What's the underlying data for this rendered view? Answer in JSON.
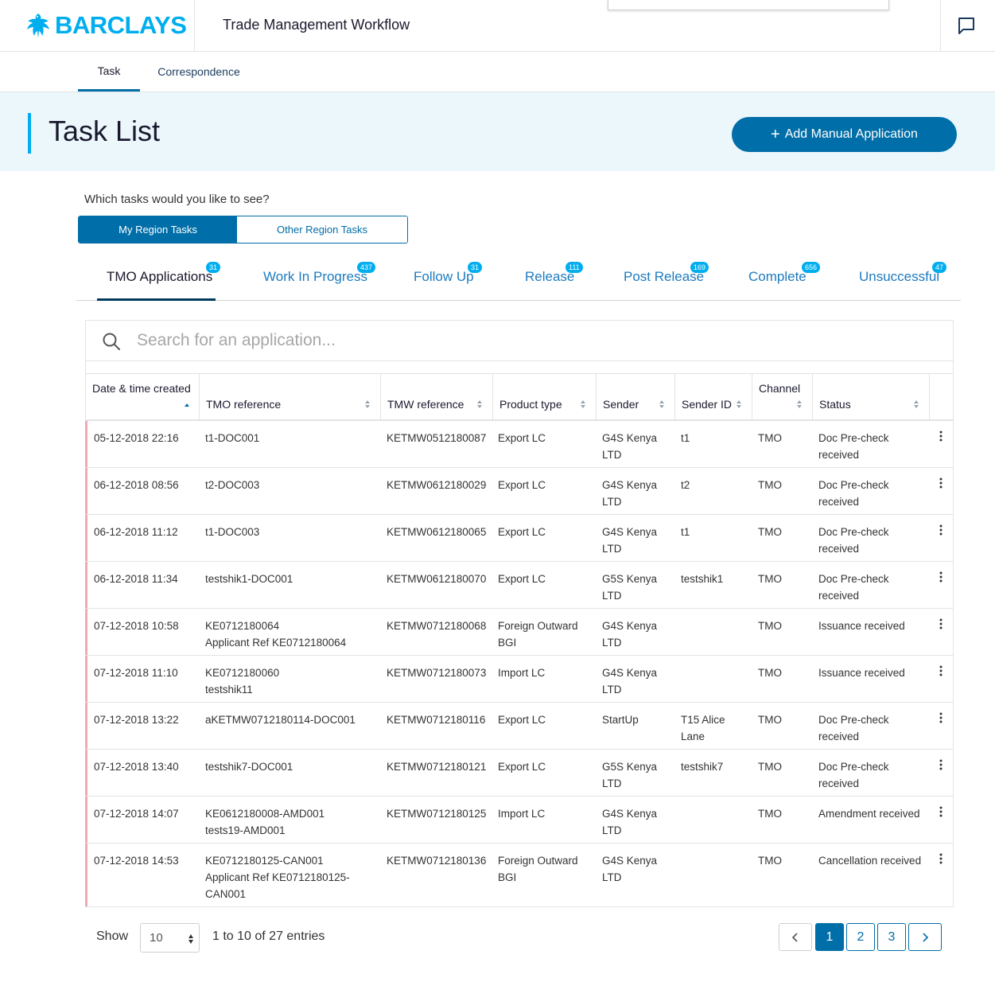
{
  "header": {
    "brand": "BARCLAYS",
    "app_title": "Trade Management Workflow",
    "chat_icon": "chat-icon"
  },
  "nav": {
    "tabs": [
      {
        "label": "Task",
        "active": true
      },
      {
        "label": "Correspondence",
        "active": false
      }
    ]
  },
  "banner": {
    "title": "Task List",
    "add_button": "Add Manual Application"
  },
  "filter": {
    "question": "Which tasks would you like to see?",
    "options": [
      "My Region Tasks",
      "Other Region Tasks"
    ],
    "selected": "My Region Tasks"
  },
  "status_tabs": [
    {
      "label": "TMO Applications",
      "count": "31",
      "active": true
    },
    {
      "label": "Work In Progress",
      "count": "437"
    },
    {
      "label": "Follow Up",
      "count": "31"
    },
    {
      "label": "Release",
      "count": "111"
    },
    {
      "label": "Post Release",
      "count": "169"
    },
    {
      "label": "Complete",
      "count": "656"
    },
    {
      "label": "Unsuccessful",
      "count": "47"
    }
  ],
  "search": {
    "placeholder": "Search for an application..."
  },
  "table": {
    "columns": [
      "Date & time created",
      "TMO reference",
      "TMW reference",
      "Product type",
      "Sender",
      "Sender ID",
      "Channel",
      "Status"
    ],
    "rows": [
      {
        "date": "05-12-2018 22:16",
        "tmo1": "t1-DOC001",
        "tmo2": "",
        "tmo3": "",
        "tmw": "KETMW0512180087",
        "prod1": "Export LC",
        "prod2": "",
        "send1": "G4S Kenya",
        "send2": "LTD",
        "sid1": "t1",
        "sid2": "",
        "chan": "TMO",
        "stat1": "Doc Pre-check",
        "stat2": "received"
      },
      {
        "date": "06-12-2018 08:56",
        "tmo1": "t2-DOC003",
        "tmo2": "",
        "tmo3": "",
        "tmw": "KETMW0612180029",
        "prod1": "Export LC",
        "prod2": "",
        "send1": "G4S Kenya",
        "send2": "LTD",
        "sid1": "t2",
        "sid2": "",
        "chan": "TMO",
        "stat1": "Doc Pre-check",
        "stat2": "received"
      },
      {
        "date": "06-12-2018 11:12",
        "tmo1": "t1-DOC003",
        "tmo2": "",
        "tmo3": "",
        "tmw": "KETMW0612180065",
        "prod1": "Export LC",
        "prod2": "",
        "send1": "G4S Kenya",
        "send2": "LTD",
        "sid1": "t1",
        "sid2": "",
        "chan": "TMO",
        "stat1": "Doc Pre-check",
        "stat2": "received"
      },
      {
        "date": "06-12-2018 11:34",
        "tmo1": "testshik1-DOC001",
        "tmo2": "",
        "tmo3": "",
        "tmw": "KETMW0612180070",
        "prod1": "Export LC",
        "prod2": "",
        "send1": "G5S Kenya",
        "send2": "LTD",
        "sid1": "testshik1",
        "sid2": "",
        "chan": "TMO",
        "stat1": "Doc Pre-check",
        "stat2": "received"
      },
      {
        "date": "07-12-2018 10:58",
        "tmo1": "KE0712180064",
        "tmo2": "Applicant Ref KE0712180064",
        "tmo3": "",
        "tmw": "KETMW0712180068",
        "prod1": "Foreign Outward",
        "prod2": "BGI",
        "send1": "G4S Kenya",
        "send2": "LTD",
        "sid1": "",
        "sid2": "",
        "chan": "TMO",
        "stat1": "Issuance received",
        "stat2": ""
      },
      {
        "date": "07-12-2018 11:10",
        "tmo1": "KE0712180060",
        "tmo2": "testshik11",
        "tmo3": "",
        "tmw": "KETMW0712180073",
        "prod1": "Import LC",
        "prod2": "",
        "send1": "G4S Kenya",
        "send2": "LTD",
        "sid1": "",
        "sid2": "",
        "chan": "TMO",
        "stat1": "Issuance received",
        "stat2": ""
      },
      {
        "date": "07-12-2018 13:22",
        "tmo1": "aKETMW0712180114-DOC001",
        "tmo2": "",
        "tmo3": "",
        "tmw": "KETMW0712180116",
        "prod1": "Export LC",
        "prod2": "",
        "send1": "StartUp",
        "send2": "",
        "sid1": "T15 Alice",
        "sid2": "Lane",
        "chan": "TMO",
        "stat1": "Doc Pre-check",
        "stat2": "received"
      },
      {
        "date": "07-12-2018 13:40",
        "tmo1": "testshik7-DOC001",
        "tmo2": "",
        "tmo3": "",
        "tmw": "KETMW0712180121",
        "prod1": "Export LC",
        "prod2": "",
        "send1": "G5S Kenya",
        "send2": "LTD",
        "sid1": "testshik7",
        "sid2": "",
        "chan": "TMO",
        "stat1": "Doc Pre-check",
        "stat2": "received"
      },
      {
        "date": "07-12-2018 14:07",
        "tmo1": "KE0612180008-AMD001",
        "tmo2": "tests19-AMD001",
        "tmo3": "",
        "tmw": "KETMW0712180125",
        "prod1": "Import LC",
        "prod2": "",
        "send1": "G4S Kenya",
        "send2": "LTD",
        "sid1": "",
        "sid2": "",
        "chan": "TMO",
        "stat1": "Amendment received",
        "stat2": ""
      },
      {
        "date": "07-12-2018 14:53",
        "tmo1": "KE0712180125-CAN001",
        "tmo2": "Applicant Ref KE0712180125-",
        "tmo3": "CAN001",
        "tmw": "KETMW0712180136",
        "prod1": "Foreign Outward",
        "prod2": "BGI",
        "send1": "G4S Kenya",
        "send2": "LTD",
        "sid1": "",
        "sid2": "",
        "chan": "TMO",
        "stat1": "Cancellation received",
        "stat2": ""
      }
    ]
  },
  "footer": {
    "show_label": "Show",
    "page_size": "10",
    "entries_text": "1 to 10 of 27 entries",
    "pages": [
      "1",
      "2",
      "3"
    ],
    "current_page": "1"
  },
  "colors": {
    "brand": "#00aeef",
    "primary": "#006ea8",
    "banner_bg": "#ecf7fc",
    "row_accent": "#f2a7b5"
  }
}
